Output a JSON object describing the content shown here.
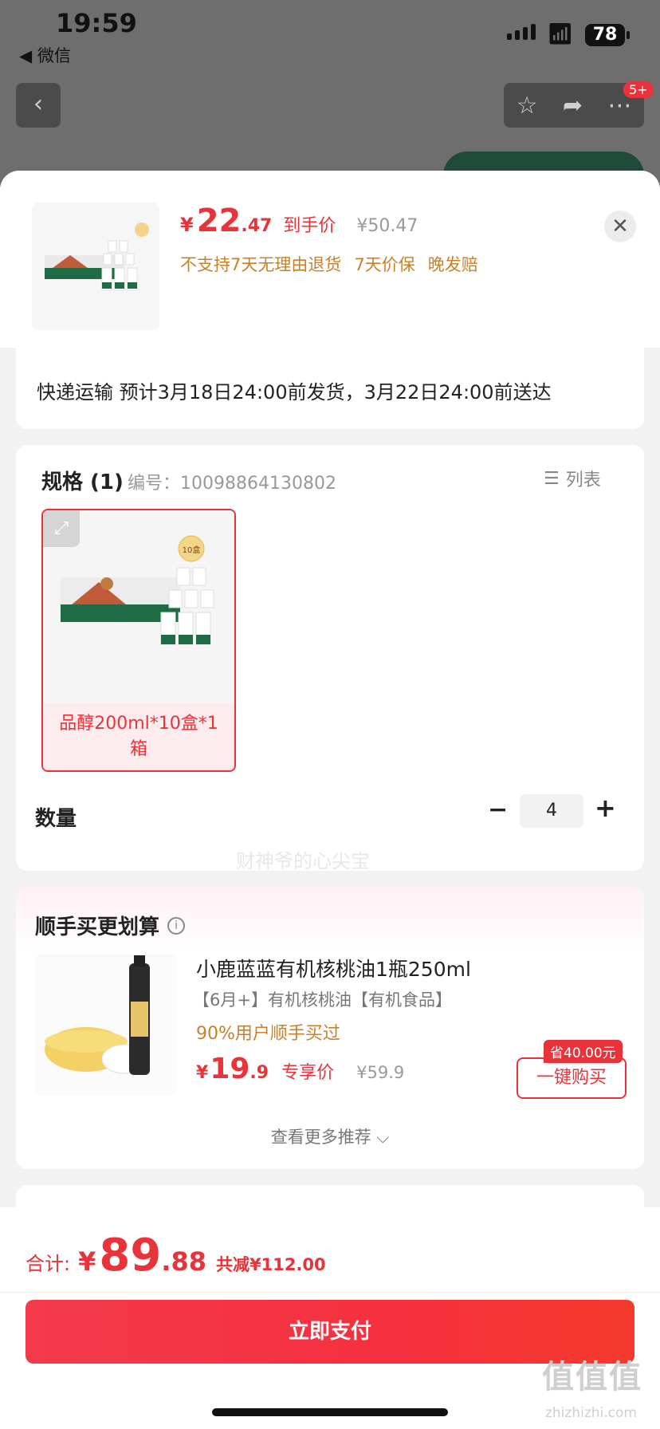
{
  "status_bar": {
    "time": "19:59",
    "back_app": "◀ 微信",
    "battery": "78"
  },
  "header": {
    "badge": "5+"
  },
  "product": {
    "price_currency": "¥",
    "price_int": "22",
    "price_dec": ".47",
    "price_label": "到手价",
    "original_price": "¥50.47",
    "tags": [
      "不支持7天无理由退货",
      "7天价保",
      "晚发赔"
    ]
  },
  "shipping": {
    "text": "快递运输 预计3月18日24:00前发货，3月22日24:00前送达"
  },
  "spec": {
    "title": "规格 (1)",
    "code": "编号：10098864130802",
    "list_label": "列表",
    "option_label": "品醇200ml*10盒*1箱",
    "image_badge": "10盒"
  },
  "quantity": {
    "label": "数量",
    "value": "4",
    "minus": "−",
    "plus": "+"
  },
  "upsell": {
    "title": "顺手买更划算",
    "item_name": "小鹿蓝蓝有机核桃油1瓶250ml",
    "item_sub": "【6月+】有机核桃油【有机食品】",
    "item_social": "90%用户顺手买过",
    "price_currency": "¥",
    "price_int": "19",
    "price_dec": ".9",
    "price_label": "专享价",
    "original_price": "¥59.9",
    "save_badge": "省40.00元",
    "buy_button": "一键购买",
    "more": "查看更多推荐 ⌵"
  },
  "watermark": "财神爷的心尖宝",
  "footer": {
    "total_label": "合计:",
    "total_currency": "¥",
    "total_int": "89",
    "total_dec": ".88",
    "saved": "共减¥112.00",
    "pay_button": "立即支付",
    "site_logo": "值值值",
    "site_url": "zhizhizhi.com"
  }
}
